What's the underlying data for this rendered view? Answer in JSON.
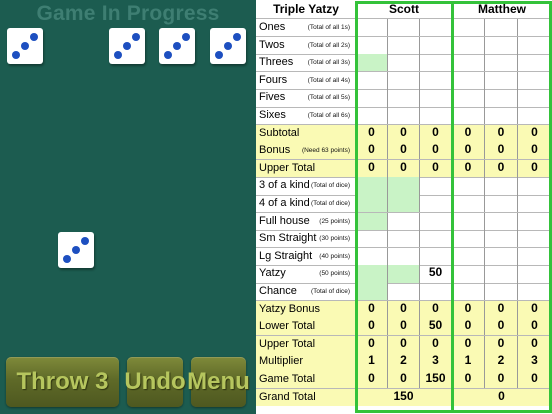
{
  "status": "Game In Progress",
  "buttons": {
    "throw": "Throw 3",
    "undo": "Undo",
    "menu": "Menu"
  },
  "dice": [
    3,
    3,
    3,
    3,
    3
  ],
  "sheet": {
    "title": "Triple Yatzy",
    "players": [
      "Scott",
      "Matthew"
    ],
    "rows": [
      {
        "label": "Ones",
        "hint": "(Total of all 1s)",
        "type": "score",
        "p0": [
          "",
          "",
          ""
        ],
        "p1": [
          "",
          "",
          ""
        ]
      },
      {
        "label": "Twos",
        "hint": "(Total of all 2s)",
        "type": "score",
        "p0": [
          "",
          "",
          ""
        ],
        "p1": [
          "",
          "",
          ""
        ]
      },
      {
        "label": "Threes",
        "hint": "(Total of all 3s)",
        "type": "score",
        "p0": [
          "",
          "",
          ""
        ],
        "p1": [
          "",
          "",
          ""
        ]
      },
      {
        "label": "Fours",
        "hint": "(Total of all 4s)",
        "type": "score",
        "p0": [
          "",
          "",
          ""
        ],
        "p1": [
          "",
          "",
          ""
        ]
      },
      {
        "label": "Fives",
        "hint": "(Total of all 5s)",
        "type": "score",
        "p0": [
          "",
          "",
          ""
        ],
        "p1": [
          "",
          "",
          ""
        ]
      },
      {
        "label": "Sixes",
        "hint": "(Total of all 6s)",
        "type": "score",
        "p0": [
          "",
          "",
          ""
        ],
        "p1": [
          "",
          "",
          ""
        ]
      },
      {
        "label": "Subtotal",
        "hint": "",
        "type": "summary",
        "p0": [
          "0",
          "0",
          "0"
        ],
        "p1": [
          "0",
          "0",
          "0"
        ]
      },
      {
        "label": "Bonus",
        "hint": "(Need 63 points)",
        "type": "summary",
        "p0": [
          "0",
          "0",
          "0"
        ],
        "p1": [
          "0",
          "0",
          "0"
        ]
      },
      {
        "label": "Upper Total",
        "hint": "",
        "type": "summary",
        "p0": [
          "0",
          "0",
          "0"
        ],
        "p1": [
          "0",
          "0",
          "0"
        ]
      },
      {
        "label": "3 of a kind",
        "hint": "(Total of dice)",
        "type": "score",
        "p0": [
          "",
          "",
          ""
        ],
        "p1": [
          "",
          "",
          ""
        ]
      },
      {
        "label": "4 of a kind",
        "hint": "(Total of dice)",
        "type": "score",
        "p0": [
          "",
          "",
          ""
        ],
        "p1": [
          "",
          "",
          ""
        ]
      },
      {
        "label": "Full house",
        "hint": "(25 points)",
        "type": "score",
        "p0": [
          "",
          "",
          ""
        ],
        "p1": [
          "",
          "",
          ""
        ]
      },
      {
        "label": "Sm Straight",
        "hint": "(30 points)",
        "type": "score",
        "p0": [
          "",
          "",
          ""
        ],
        "p1": [
          "",
          "",
          ""
        ]
      },
      {
        "label": "Lg Straight",
        "hint": "(40 points)",
        "type": "score",
        "p0": [
          "",
          "",
          ""
        ],
        "p1": [
          "",
          "",
          ""
        ]
      },
      {
        "label": "Yatzy",
        "hint": "(50 points)",
        "type": "score",
        "p0": [
          "",
          "",
          "50"
        ],
        "p1": [
          "",
          "",
          ""
        ]
      },
      {
        "label": "Chance",
        "hint": "(Total of dice)",
        "type": "score",
        "p0": [
          "",
          "",
          ""
        ],
        "p1": [
          "",
          "",
          ""
        ]
      },
      {
        "label": "Yatzy Bonus",
        "hint": "",
        "type": "summary",
        "p0": [
          "0",
          "0",
          "0"
        ],
        "p1": [
          "0",
          "0",
          "0"
        ]
      },
      {
        "label": "Lower Total",
        "hint": "",
        "type": "summary",
        "p0": [
          "0",
          "0",
          "50"
        ],
        "p1": [
          "0",
          "0",
          "0"
        ]
      },
      {
        "label": "Upper Total",
        "hint": "",
        "type": "summary",
        "p0": [
          "0",
          "0",
          "0"
        ],
        "p1": [
          "0",
          "0",
          "0"
        ]
      },
      {
        "label": "Multiplier",
        "hint": "",
        "type": "summary",
        "p0": [
          "1",
          "2",
          "3"
        ],
        "p1": [
          "1",
          "2",
          "3"
        ]
      },
      {
        "label": "Game Total",
        "hint": "",
        "type": "summary",
        "p0": [
          "0",
          "0",
          "150"
        ],
        "p1": [
          "0",
          "0",
          "0"
        ]
      }
    ],
    "grand_total": {
      "label": "Grand Total",
      "values": [
        "150",
        "0"
      ]
    },
    "highlight_cells": [
      {
        "row": 2,
        "player": 0,
        "col": 0
      },
      {
        "row": 9,
        "player": 0,
        "col": 0
      },
      {
        "row": 9,
        "player": 0,
        "col": 1
      },
      {
        "row": 10,
        "player": 0,
        "col": 0
      },
      {
        "row": 10,
        "player": 0,
        "col": 1
      },
      {
        "row": 11,
        "player": 0,
        "col": 0
      },
      {
        "row": 14,
        "player": 0,
        "col": 0
      },
      {
        "row": 14,
        "player": 0,
        "col": 1
      },
      {
        "row": 15,
        "player": 0,
        "col": 0
      }
    ],
    "colors": {
      "highlight": "#c9f3c6",
      "summary": "#fafab4",
      "frame": "#34c23a",
      "pip": "#1d4fc0",
      "table": "#1c5c50"
    }
  }
}
